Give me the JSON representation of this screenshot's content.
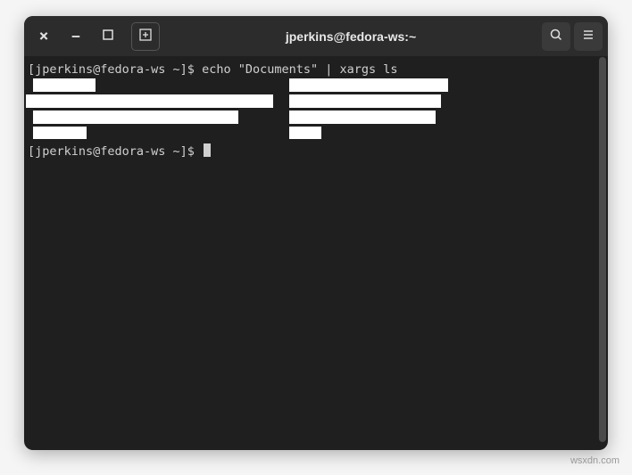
{
  "titlebar": {
    "close_icon": "×",
    "minimize_icon": "−",
    "title": "jperkins@fedora-ws:~"
  },
  "terminal": {
    "prompt1": "[jperkins@fedora-ws ~]$ ",
    "command1": "echo \"Documents\" | xargs ls",
    "prompt2": "[jperkins@fedora-ws ~]$ "
  },
  "watermark": "wsxdn.com"
}
